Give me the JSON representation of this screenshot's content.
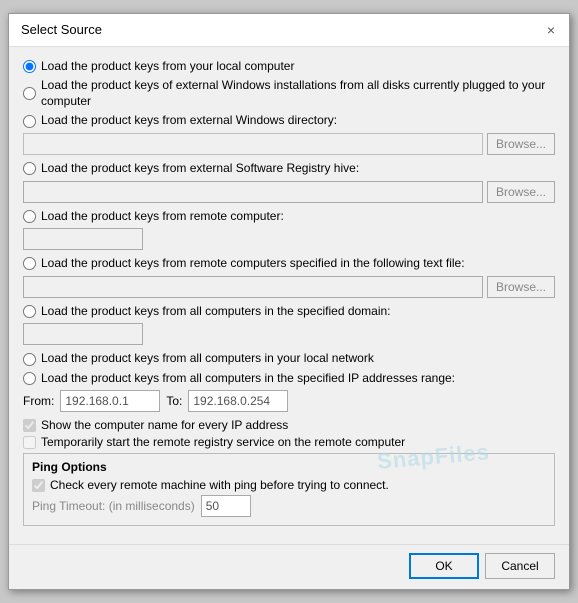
{
  "dialog": {
    "title": "Select Source",
    "close_label": "×"
  },
  "options": {
    "radio1_label": "Load the product keys from your local computer",
    "radio2_label": "Load the product keys of external Windows installations from all disks currently plugged to your computer",
    "radio3_label": "Load the product keys from external Windows directory:",
    "radio3_browse": "Browse...",
    "radio4_label": "Load the product keys from external Software Registry hive:",
    "radio4_browse": "Browse...",
    "radio5_label": "Load the product keys from remote computer:",
    "radio6_label": "Load the product keys from remote computers specified in the following text file:",
    "radio6_browse": "Browse...",
    "radio7_label": "Load the product keys from all computers in the specified domain:",
    "radio8_label": "Load the product keys from all computers in your local network",
    "radio9_label": "Load the product keys from all computers in the specified IP addresses range:",
    "from_label": "From:",
    "from_value": "192.168.0.1",
    "to_label": "To:",
    "to_value": "192.168.0.254",
    "check1_label": "Show the computer name for every IP address",
    "check2_label": "Temporarily start the remote registry service on the remote computer"
  },
  "ping": {
    "section_title": "Ping Options",
    "check_label": "Check every remote machine with ping before trying to connect.",
    "timeout_label": "Ping Timeout: (in milliseconds)",
    "timeout_value": "50"
  },
  "buttons": {
    "ok": "OK",
    "cancel": "Cancel"
  },
  "watermark": "SnapFiles"
}
